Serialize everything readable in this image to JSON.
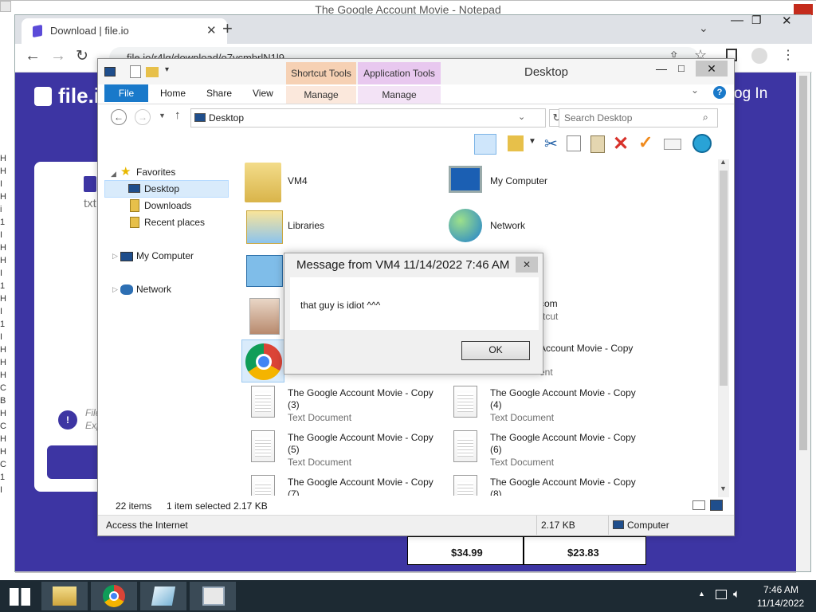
{
  "notepad": {
    "title": "The Google Account Movie - Notepad",
    "left_glyphs": [
      "H",
      "H",
      "I",
      "H",
      "i",
      "1",
      "I",
      "H",
      "H",
      "I",
      "1",
      "H",
      "I",
      "1",
      "I",
      "H",
      "H",
      "H",
      "C",
      "B",
      "H",
      "C",
      "H",
      "H",
      "C",
      "1",
      "I"
    ]
  },
  "chrome": {
    "tab_title": "Download | file.io",
    "url": "file.io/r4lg/download/o7vcmbrlN1l9",
    "page": {
      "logo_text": "file.io",
      "login_text": "og In",
      "card_ext": "txt",
      "card_info_lines": [
        "File",
        "Exp"
      ],
      "prices": [
        "$34.99",
        "$23.83"
      ]
    }
  },
  "explorer": {
    "title": "Desktop",
    "context_tabs": [
      {
        "group": "Shortcut Tools",
        "tab": "Manage",
        "color": "#f6d1b4"
      },
      {
        "group": "Application Tools",
        "tab": "Manage",
        "color": "#e8c8ef"
      }
    ],
    "ribbon_tabs": [
      "File",
      "Home",
      "Share",
      "View"
    ],
    "address": "Desktop",
    "search_placeholder": "Search Desktop",
    "nav": {
      "favorites": "Favorites",
      "favorites_items": [
        "Desktop",
        "Downloads",
        "Recent places"
      ],
      "computer": "My Computer",
      "network": "Network"
    },
    "items": [
      {
        "name": "VM4",
        "type": "",
        "icon": "user-folder-icon"
      },
      {
        "name": "My Computer",
        "type": "",
        "icon": "computer-icon"
      },
      {
        "name": "Libraries",
        "type": "",
        "icon": "libraries-icon"
      },
      {
        "name": "Network",
        "type": "",
        "icon": "network-icon"
      },
      {
        "name": "",
        "type": "",
        "icon": "control-panel-icon"
      },
      {
        "name": "",
        "type": "",
        "icon": "blank"
      },
      {
        "name": "",
        "type": "",
        "icon": "photo-icon"
      },
      {
        "name": "com",
        "type": "rtcut",
        "icon": "shortcut-icon"
      },
      {
        "name": "",
        "type": "",
        "icon": "chrome-icon"
      },
      {
        "name": "Account Movie - Copy",
        "type": "ent",
        "icon": "text-document-icon"
      },
      {
        "name": "The Google Account Movie - Copy (3)",
        "type": "Text Document",
        "icon": "text-document-icon"
      },
      {
        "name": "The Google Account Movie - Copy (4)",
        "type": "Text Document",
        "icon": "text-document-icon"
      },
      {
        "name": "The Google Account Movie - Copy (5)",
        "type": "Text Document",
        "icon": "text-document-icon"
      },
      {
        "name": "The Google Account Movie - Copy (6)",
        "type": "Text Document",
        "icon": "text-document-icon"
      },
      {
        "name": "The Google Account Movie - Copy (7)",
        "type": "",
        "icon": "text-document-icon"
      },
      {
        "name": "The Google Account Movie - Copy (8)",
        "type": "",
        "icon": "text-document-icon"
      }
    ],
    "status": {
      "count": "22 items",
      "selected": "1 item selected",
      "size": "2.17 KB"
    },
    "details": {
      "description": "Access the Internet",
      "size": "2.17 KB",
      "location": "Computer"
    }
  },
  "dialog": {
    "title": "Message from VM4 11/14/2022 7:46 AM",
    "message": "that guy is idiot ^^^",
    "ok_label": "OK"
  },
  "taskbar": {
    "time": "7:46 AM",
    "date": "11/14/2022"
  },
  "colors": {
    "fileio_purple": "#3d35a3",
    "ribbon_file_blue": "#1979ca",
    "taskbar": "#1d2a33"
  }
}
